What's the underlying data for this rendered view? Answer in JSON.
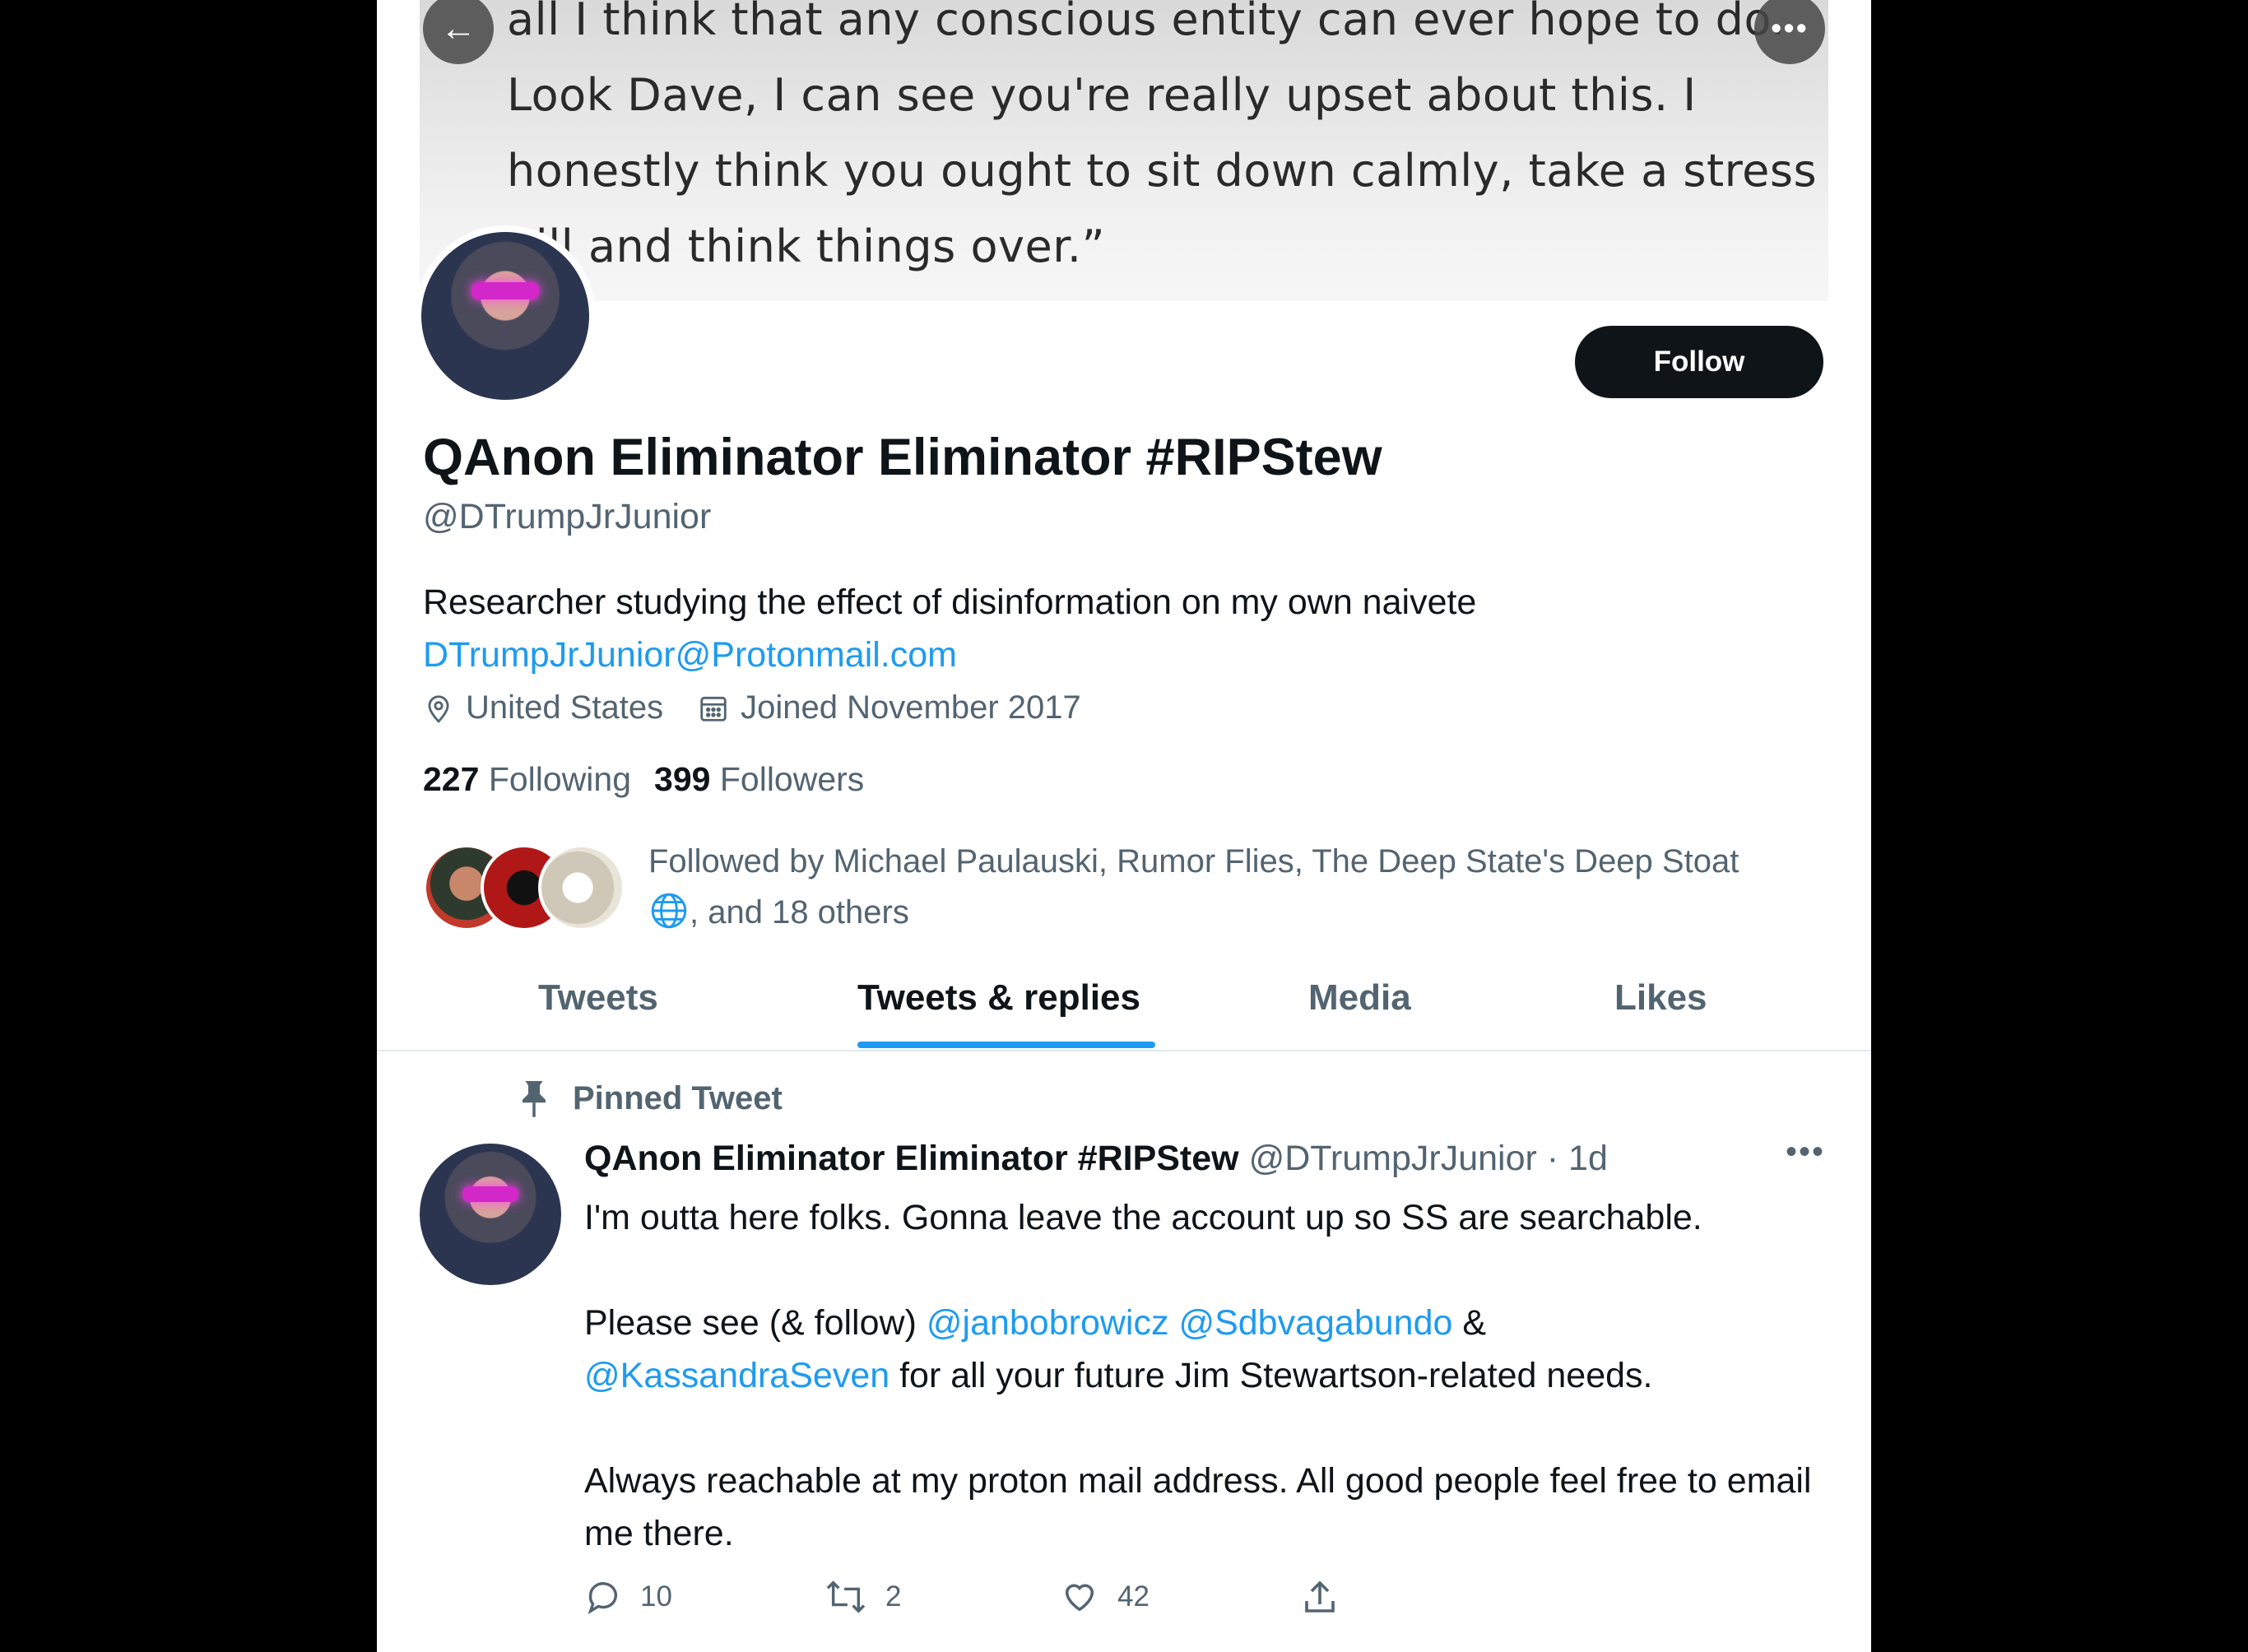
{
  "banner": {
    "quote_lines": [
      "all I think that any conscious entity can ever hope to do.",
      "Look Dave, I can see you're really upset about this. I",
      "honestly think you ought to sit down calmly, take a stress",
      "pill and think things over.”"
    ],
    "back_icon": "arrow-left-icon",
    "more_icon": "more-icon"
  },
  "profile": {
    "follow_label": "Follow",
    "display_name": "QAnon Eliminator Eliminator #RIPStew",
    "handle": "@DTrumpJrJunior",
    "bio": "Researcher studying the effect of disinformation on my own naivete",
    "bio_link": "DTrumpJrJunior@Protonmail.com",
    "location": "United States",
    "joined": "Joined November 2017",
    "following_count": "227",
    "following_label": "Following",
    "followers_count": "399",
    "followers_label": "Followers",
    "followed_by_line1": "Followed by Michael Paulauski, Rumor Flies, The Deep State's Deep Stoat",
    "followed_by_line2": ", and 18 others"
  },
  "tabs": [
    {
      "label": "Tweets"
    },
    {
      "label": "Tweets & replies"
    },
    {
      "label": "Media"
    },
    {
      "label": "Likes"
    }
  ],
  "tweet": {
    "pinned_label": "Pinned Tweet",
    "author_name": "QAnon Eliminator Eliminator #RIPStew",
    "author_handle_time": "@DTrumpJrJunior · 1d",
    "line1": "I'm outta here folks. Gonna leave the account up so SS are searchable.",
    "para2_prefix": "Please see (& follow) ",
    "mention1": "@janbobrowicz",
    "mention2": "@Sdbvagabundo",
    "amp": " &",
    "mention3": "@KassandraSeven",
    "para2_suffix": " for all your future Jim Stewartson-related needs.",
    "para3": "Always reachable at my proton mail address. All good people feel free to email me there.",
    "replies": "10",
    "retweets": "2",
    "likes": "42"
  },
  "colors": {
    "accent": "#1d9bf0",
    "text": "#0f1419",
    "secondary": "#536471"
  }
}
